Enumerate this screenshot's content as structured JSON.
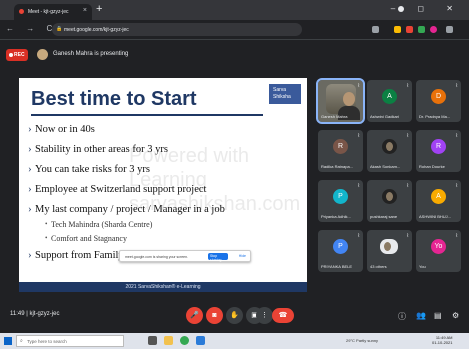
{
  "browser": {
    "tab_title": "Meet - kjt-gzyz-jec",
    "tab_close": "×",
    "new_tab": "+",
    "window_controls": "–  ◻  ✕",
    "nav_buttons": "← → C",
    "url": "meet.google.com/kjt-gzyz-jec",
    "lock": "🔒"
  },
  "meet": {
    "rec_label": "REC",
    "presenting_text": "Ganesh Mahra is presenting",
    "meeting_time": "11:49  |  kjt-gzyz-jec",
    "leave_icon": "☎",
    "accent": "#ea4335"
  },
  "slide": {
    "title": "Best time to Start",
    "logo_text": "Sarva Shiksha",
    "bullets": [
      "Now or in 40s",
      "Stability in other areas for 3 yrs",
      "You can take risks for 3 yrs",
      "Employee at Switzerland support project",
      "My last company / project / Manager in a job"
    ],
    "sub_bullets": [
      "Tech Mahindra (Sharda Centre)",
      "Comfort and Stagnancy"
    ],
    "last_bullet": "Support from Family members, Stakeholders",
    "watermark": "Powered with Learning sarvashikshan.com",
    "footer": "2021 SarvaShikshan® e-Learning",
    "share_banner_text": "meet.google.com is sharing your screen.",
    "share_banner_stop": "Stop sharing",
    "share_banner_hide": "Hide"
  },
  "participants": [
    {
      "name": "Ganesh Mahra",
      "initial": "",
      "color": "#6a6a62",
      "video": true
    },
    {
      "name": "Ashwini Gadkari",
      "initial": "A",
      "color": "#0b8043"
    },
    {
      "name": "Dr. Pradnya Ma...",
      "initial": "D",
      "color": "#e8710a"
    },
    {
      "name": "Radika Ratnapa...",
      "initial": "R",
      "color": "#795548"
    },
    {
      "name": "Akash Sonkam...",
      "initial": "",
      "color": "#3c4043",
      "pic": true
    },
    {
      "name": "Rohan Dourke",
      "initial": "R",
      "color": "#a142f4"
    },
    {
      "name": "Priyanka Adhik...",
      "initial": "P",
      "color": "#12b5cb"
    },
    {
      "name": "pushkaraj sane",
      "initial": "",
      "color": "#3c4043",
      "pic": true
    },
    {
      "name": "ASHWINI BHUJ...",
      "initial": "A",
      "color": "#f9ab00"
    },
    {
      "name": "PRIYANKA BELE",
      "initial": "P",
      "color": "#4285f4"
    },
    {
      "name": "43 others",
      "initial": "",
      "color": "#3c4043",
      "others": true
    },
    {
      "name": "You",
      "initial": "Yo",
      "color": "#e52592"
    }
  ],
  "taskbar": {
    "search_placeholder": "Type here to search",
    "weather": "29°C  Partly sunny",
    "time": "11:49 AM",
    "date": "01-10-2021"
  }
}
